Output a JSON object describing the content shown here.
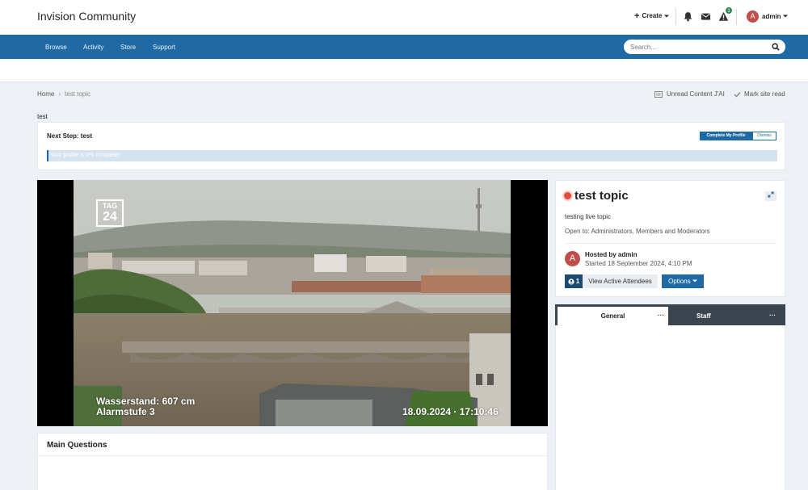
{
  "header": {
    "site_title": "Invision Community",
    "create_label": "Create",
    "notification_count": "1",
    "user_initial": "A",
    "user_name": "admin"
  },
  "nav": {
    "items": [
      {
        "label": "Browse"
      },
      {
        "label": "Activity"
      },
      {
        "label": "Store"
      },
      {
        "label": "Support"
      }
    ],
    "search_placeholder": "Search..."
  },
  "breadcrumb": {
    "home": "Home",
    "current": "test topic"
  },
  "page_actions": {
    "unread": "Unread Content J'AI",
    "mark_read": "Mark site read"
  },
  "intro_text": "test",
  "next_step": {
    "title": "Next Step: test",
    "complete_button": "Complete My Profile",
    "dismiss_button": "Dismiss",
    "progress_text": "Your profile is 0% complete!",
    "progress_percent": 0
  },
  "video": {
    "logo_line1": "TAG",
    "logo_line2": "24",
    "water_level": "Wasserstand: 607 cm",
    "alarm_level": "Alarmstufe 3",
    "timestamp": "18.09.2024 · 17:10:46"
  },
  "main_questions": {
    "title": "Main Questions"
  },
  "topic": {
    "title": "test topic",
    "description": "testing live topic",
    "open_to": "Open to: Administrators, Members and Moderators",
    "host_initial": "A",
    "hosted_by": "Hosted by admin",
    "started": "Started 18 September 2024, 4:10 PM",
    "attendee_count": "1",
    "view_attendees": "View Active Attendees",
    "options": "Options"
  },
  "tabs": {
    "general": "General",
    "staff": "Staff",
    "menu_glyph": "···"
  },
  "colors": {
    "brand_blue": "#1f6aa5",
    "live_red": "#e5493a",
    "avatar_red": "#c14d48",
    "badge_green": "#2e8b57"
  }
}
